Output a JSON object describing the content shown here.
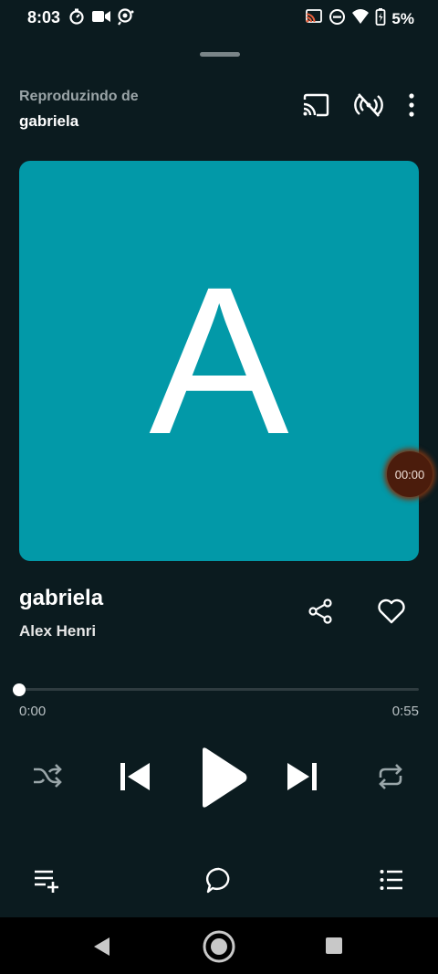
{
  "status_bar": {
    "time": "8:03",
    "battery_text": "5%",
    "left_icons": [
      "timer-icon",
      "video-icon",
      "notification-icon"
    ],
    "right_icons": [
      "cast-status-icon",
      "do-not-disturb-icon",
      "wifi-icon",
      "battery-icon"
    ]
  },
  "header": {
    "playing_from_label": "Reproduzindo de",
    "playing_from_name": "gabriela",
    "actions": [
      "cast-icon",
      "no-signal-icon",
      "more-vertical-icon"
    ]
  },
  "album": {
    "letter": "A",
    "color": "#0299a8"
  },
  "floating_timer": {
    "text": "00:00"
  },
  "track": {
    "title": "gabriela",
    "artist": "Alex Henri"
  },
  "progress": {
    "elapsed": "0:00",
    "total": "0:55",
    "fraction": 0
  },
  "controls": [
    "shuffle-icon",
    "previous-icon",
    "play-icon",
    "next-icon",
    "repeat-icon"
  ],
  "bottom_actions": [
    "add-to-queue-icon",
    "lyrics-icon",
    "queue-list-icon"
  ],
  "nav": [
    "back-icon",
    "home-icon",
    "recents-icon"
  ]
}
